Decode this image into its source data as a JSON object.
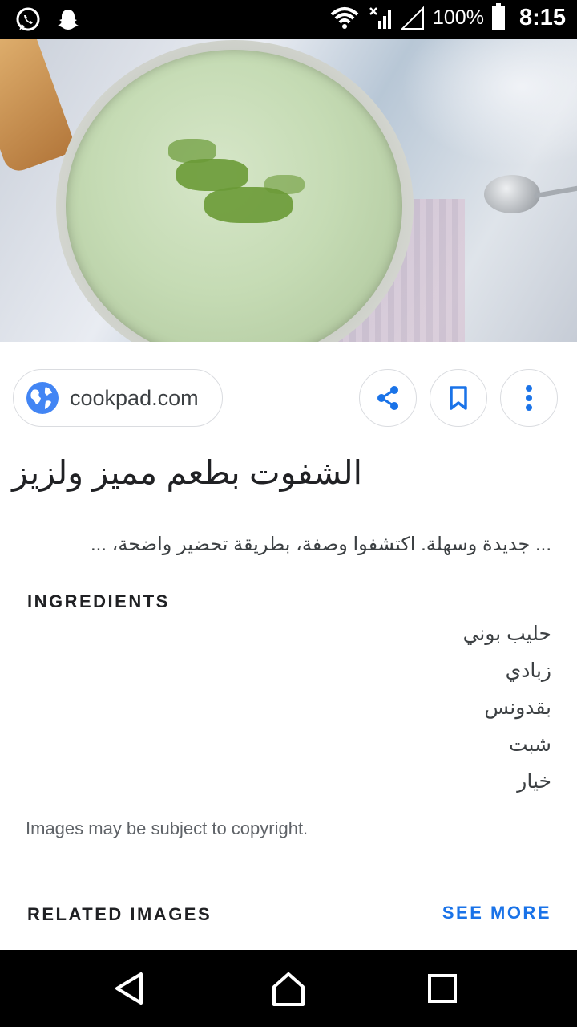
{
  "status_bar": {
    "battery_percent": "100%",
    "time": "8:15",
    "left_icons": [
      "whatsapp-icon",
      "snapchat-icon"
    ],
    "right_icons": [
      "wifi-icon",
      "signal-icon",
      "signal-empty-icon",
      "battery-icon"
    ]
  },
  "result": {
    "source": "cookpad.com",
    "title": "الشفوت بطعم مميز ولزيز",
    "snippet": "... جديدة وسهلة. اكتشفوا وصفة، بطريقة تحضير واضحة، ...",
    "actions": [
      "share-icon",
      "bookmark-icon",
      "more-vert-icon"
    ]
  },
  "ingredients": {
    "label": "INGREDIENTS",
    "items": [
      "حليب بوني",
      "زبادي",
      "بقدونس",
      "شبت",
      "خيار"
    ]
  },
  "copyright_note": "Images may be subject to copyright.",
  "related": {
    "label": "RELATED IMAGES",
    "see_more": "SEE MORE"
  },
  "colors": {
    "accent": "#1a73e8",
    "text": "#202124",
    "border": "#dadce0"
  }
}
